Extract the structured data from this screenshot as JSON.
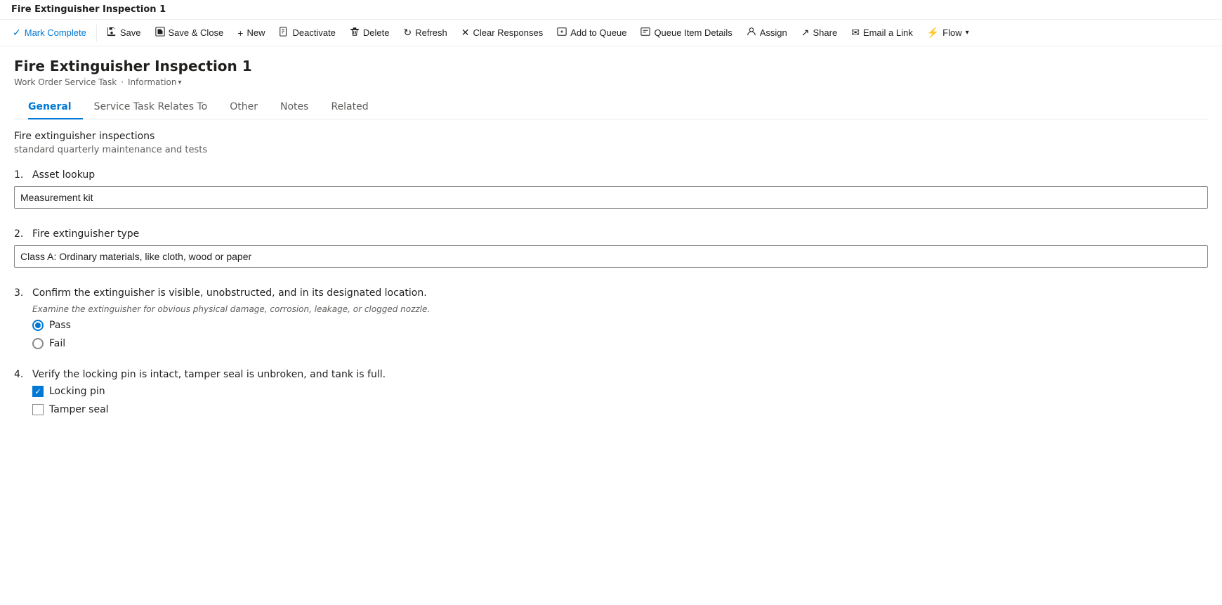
{
  "titleBar": {
    "title": "Fire Extinguisher Inspection 1"
  },
  "commandBar": {
    "buttons": [
      {
        "id": "mark-complete",
        "label": "Mark Complete",
        "icon": "✓",
        "isPrimary": true
      },
      {
        "id": "save",
        "label": "Save",
        "icon": "💾"
      },
      {
        "id": "save-close",
        "label": "Save & Close",
        "icon": "🗂"
      },
      {
        "id": "new",
        "label": "New",
        "icon": "+"
      },
      {
        "id": "deactivate",
        "label": "Deactivate",
        "icon": "📄"
      },
      {
        "id": "delete",
        "label": "Delete",
        "icon": "🗑"
      },
      {
        "id": "refresh",
        "label": "Refresh",
        "icon": "↻"
      },
      {
        "id": "clear-responses",
        "label": "Clear Responses",
        "icon": "✕"
      },
      {
        "id": "add-to-queue",
        "label": "Add to Queue",
        "icon": "📋"
      },
      {
        "id": "queue-item-details",
        "label": "Queue Item Details",
        "icon": "📋"
      },
      {
        "id": "assign",
        "label": "Assign",
        "icon": "👤"
      },
      {
        "id": "share",
        "label": "Share",
        "icon": "↗"
      },
      {
        "id": "email-link",
        "label": "Email a Link",
        "icon": "✉"
      },
      {
        "id": "flow",
        "label": "Flow",
        "icon": "⚡"
      }
    ]
  },
  "record": {
    "title": "Fire Extinguisher Inspection 1",
    "subtitle": "Work Order Service Task",
    "infoLabel": "Information"
  },
  "tabs": [
    {
      "id": "general",
      "label": "General",
      "active": true
    },
    {
      "id": "service-task-relates-to",
      "label": "Service Task Relates To",
      "active": false
    },
    {
      "id": "other",
      "label": "Other",
      "active": false
    },
    {
      "id": "notes",
      "label": "Notes",
      "active": false
    },
    {
      "id": "related",
      "label": "Related",
      "active": false
    }
  ],
  "form": {
    "sectionTitle": "Fire extinguisher inspections",
    "sectionSubtitle": "standard quarterly maintenance and tests",
    "questions": [
      {
        "id": "q1",
        "number": "1.",
        "label": "Asset lookup",
        "type": "input",
        "value": "Measurement kit",
        "hint": ""
      },
      {
        "id": "q2",
        "number": "2.",
        "label": "Fire extinguisher type",
        "type": "input",
        "value": "Class A: Ordinary materials, like cloth, wood or paper",
        "hint": ""
      },
      {
        "id": "q3",
        "number": "3.",
        "label": "Confirm the extinguisher is visible, unobstructed, and in its designated location.",
        "type": "radio",
        "hint": "Examine the extinguisher for obvious physical damage, corrosion, leakage, or clogged nozzle.",
        "options": [
          {
            "id": "pass",
            "label": "Pass",
            "checked": true
          },
          {
            "id": "fail",
            "label": "Fail",
            "checked": false
          }
        ]
      },
      {
        "id": "q4",
        "number": "4.",
        "label": "Verify the locking pin is intact, tamper seal is unbroken, and tank is full.",
        "type": "checkbox",
        "hint": "",
        "options": [
          {
            "id": "locking-pin",
            "label": "Locking pin",
            "checked": true
          },
          {
            "id": "tamper-seal",
            "label": "Tamper seal",
            "checked": false
          }
        ]
      }
    ]
  }
}
